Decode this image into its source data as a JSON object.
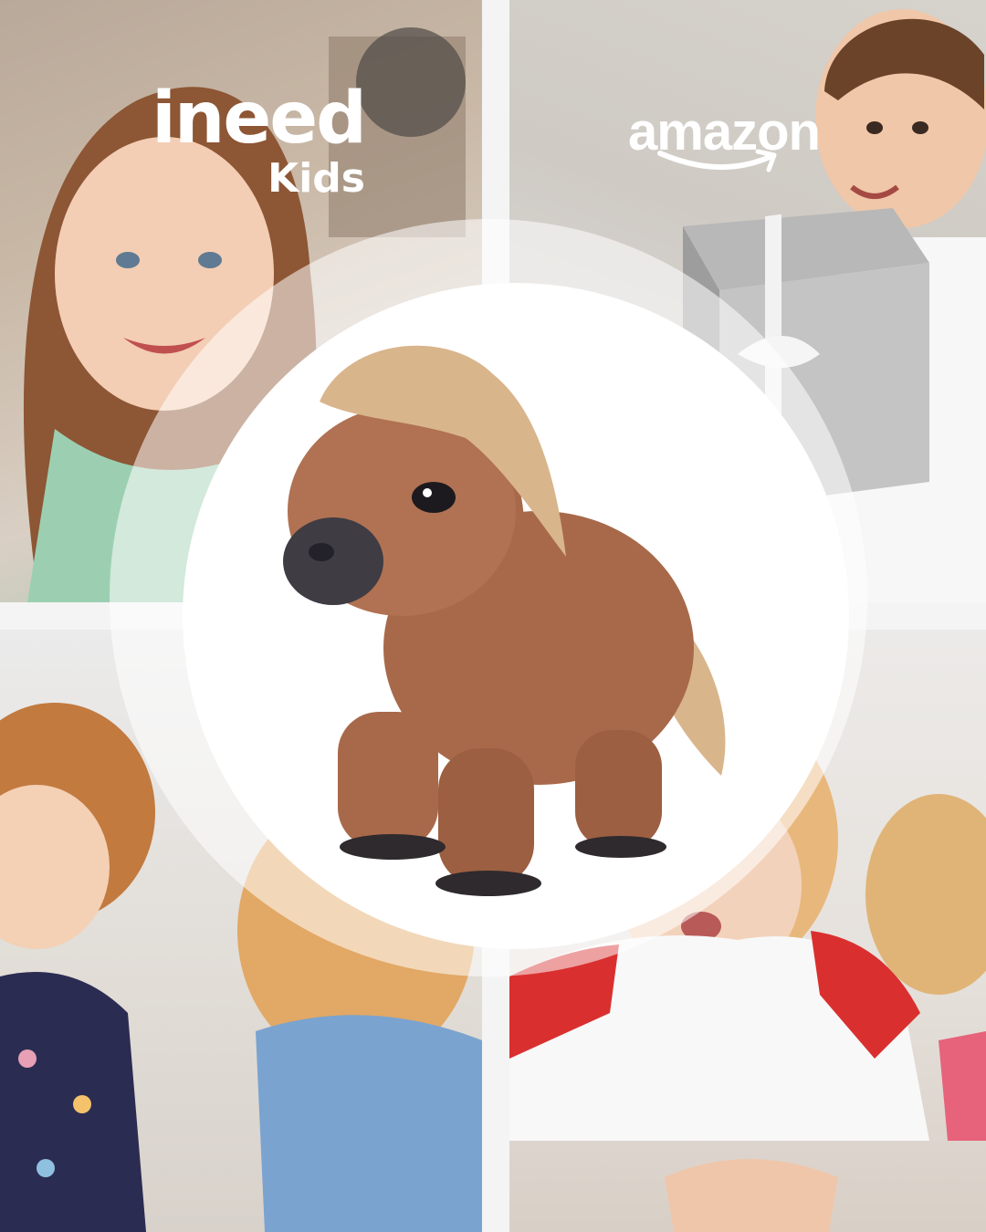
{
  "brand_left": {
    "line1": "ineed",
    "line2": "Kids"
  },
  "brand_right": {
    "word": "amazon",
    "mark_icon": "smile-arrow-icon"
  },
  "product": {
    "icon": "plush-pony-icon"
  },
  "colors": {
    "logo": "#ffffff",
    "plush_main": "#a8694a",
    "plush_mane": "#d9b58c",
    "divider": "#ffffff"
  }
}
